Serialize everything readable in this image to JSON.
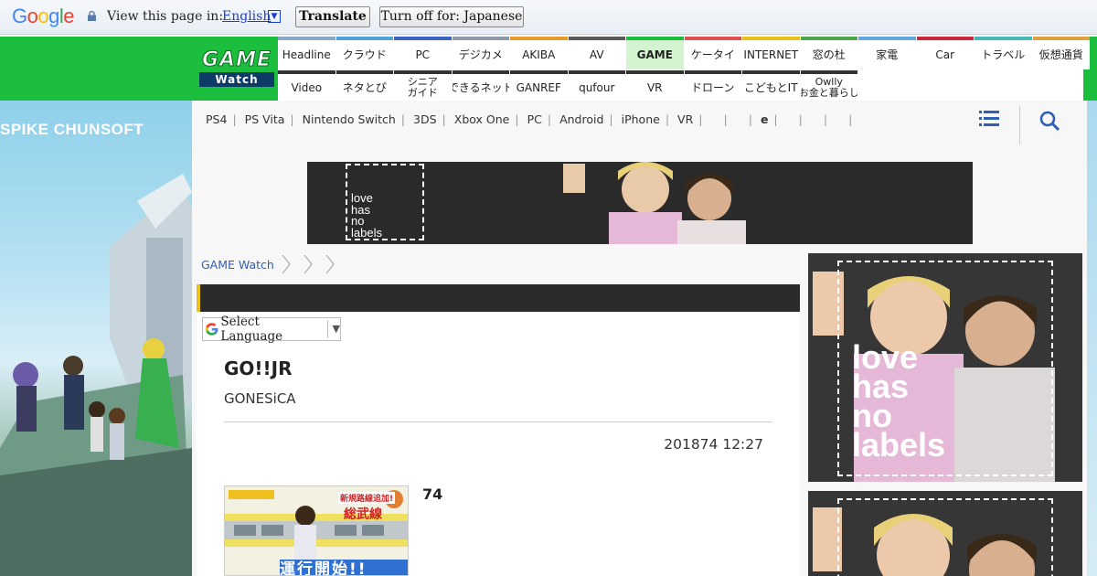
{
  "translate_bar": {
    "logo": "Google",
    "prompt": "View this page in:",
    "language": "English",
    "translate_button": "Translate",
    "turn_off_button": "Turn off for: Japanese"
  },
  "site": {
    "logo_top": "GAME",
    "logo_bottom": "Watch"
  },
  "categories_row1": [
    {
      "label": "Headline",
      "color": "#8aa6c8"
    },
    {
      "label": "クラウド",
      "color": "#4fa3d9"
    },
    {
      "label": "PC",
      "color": "#3a63c4"
    },
    {
      "label": "デジカメ",
      "color": "#8f9aa8"
    },
    {
      "label": "AKIBA",
      "color": "#e89a2c"
    },
    {
      "label": "AV",
      "color": "#5a5a5a"
    },
    {
      "label": "GAME",
      "color": "#1bbf3d"
    },
    {
      "label": "ケータイ",
      "color": "#e05050"
    },
    {
      "label": "INTERNET",
      "color": "#e8c21a"
    },
    {
      "label": "窓の杜",
      "color": "#4aa84a"
    },
    {
      "label": "家電",
      "color": "#5fa8e0"
    },
    {
      "label": "Car",
      "color": "#c8283c"
    },
    {
      "label": "トラベル",
      "color": "#46b8b8"
    },
    {
      "label": "仮想通貨",
      "color": "#e0a040"
    }
  ],
  "categories_row2": [
    {
      "label": "Video",
      "label2": ""
    },
    {
      "label": "ネタとぴ",
      "label2": ""
    },
    {
      "label": "シニア",
      "label2": "ガイド"
    },
    {
      "label": "できるネット",
      "label2": ""
    },
    {
      "label": "GANREF",
      "label2": ""
    },
    {
      "label": "qufour",
      "label2": ""
    },
    {
      "label": "VR",
      "label2": ""
    },
    {
      "label": "ドローン",
      "label2": ""
    },
    {
      "label": "こどもとIT",
      "label2": ""
    },
    {
      "label": "Owlly",
      "label2": "お金と暮らし"
    }
  ],
  "subnav": {
    "items": [
      "PS4",
      "PS Vita",
      "Nintendo Switch",
      "3DS",
      "Xbox One",
      "PC",
      "Android",
      "iPhone",
      "VR",
      "",
      "",
      "e",
      "",
      "",
      ""
    ],
    "sep": "|"
  },
  "art": {
    "title": "SPIKE CHUNSOFT"
  },
  "ad": {
    "line1": "love",
    "line2": "has",
    "line3": "no",
    "line4": "labels"
  },
  "breadcrumb": {
    "home": "GAME Watch"
  },
  "select_language": {
    "label": "Select Language",
    "arrow": "▼"
  },
  "article": {
    "title": "GO!!JR",
    "subtitle": "GONESiCA",
    "date": "201874 12:27",
    "count": "74"
  },
  "thumb": {
    "tag": "新規路線追加!",
    "line": "総武線",
    "banner": "運行開始!!"
  }
}
